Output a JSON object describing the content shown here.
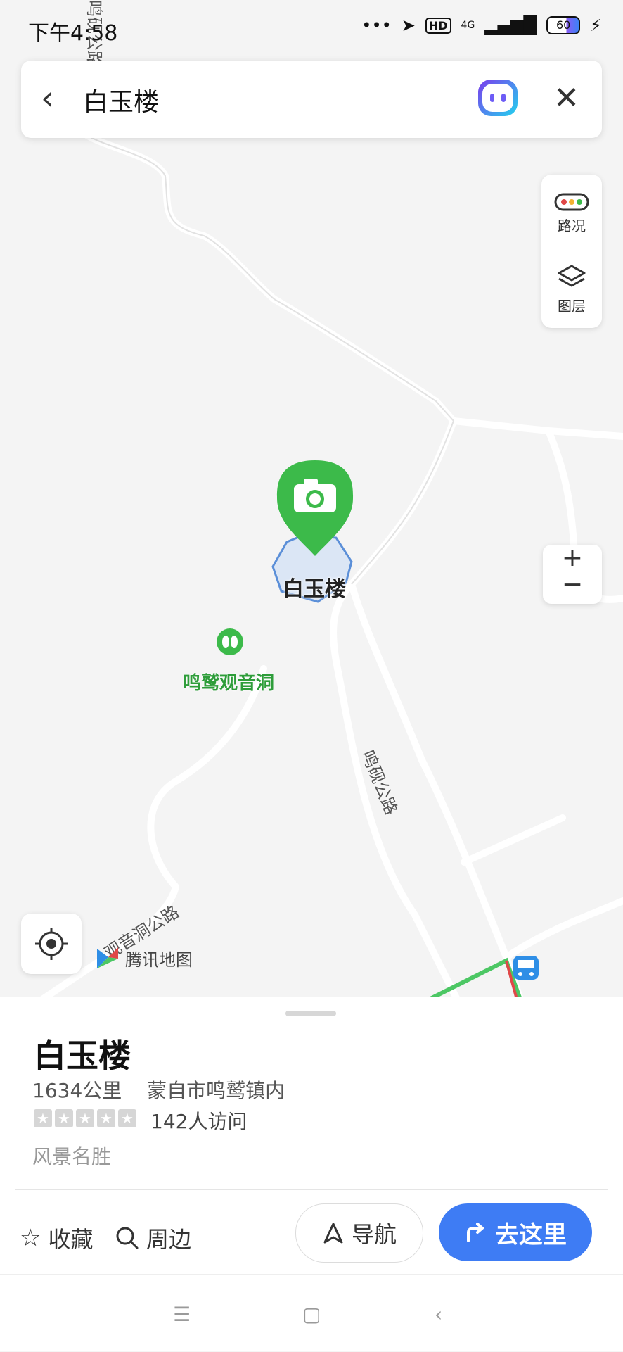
{
  "status_bar": {
    "time": "下午4:58",
    "network": "4G",
    "battery": "60"
  },
  "search": {
    "query": "白玉楼"
  },
  "map_controls": {
    "traffic_label": "路况",
    "layers_label": "图层",
    "zoom_in": "+",
    "zoom_out": "−"
  },
  "map": {
    "poi_selected": "白玉楼",
    "poi_secondary": "鸣鹫观音洞",
    "road_main": "鸣砚公路",
    "road_top": "鸣砚公路",
    "road_bottom_left": "观音洞公路",
    "brand": "腾讯地图"
  },
  "place": {
    "name": "白玉楼",
    "distance": "1634公里",
    "address": "蒙自市鸣鹫镇内",
    "visits": "142人访问",
    "category": "风景名胜"
  },
  "actions": {
    "favorite": "收藏",
    "nearby": "周边",
    "navigate": "导航",
    "go_here": "去这里"
  },
  "colors": {
    "accent": "#3e7cf4",
    "pin": "#3cba4a",
    "poi_green": "#2e9d3a"
  }
}
